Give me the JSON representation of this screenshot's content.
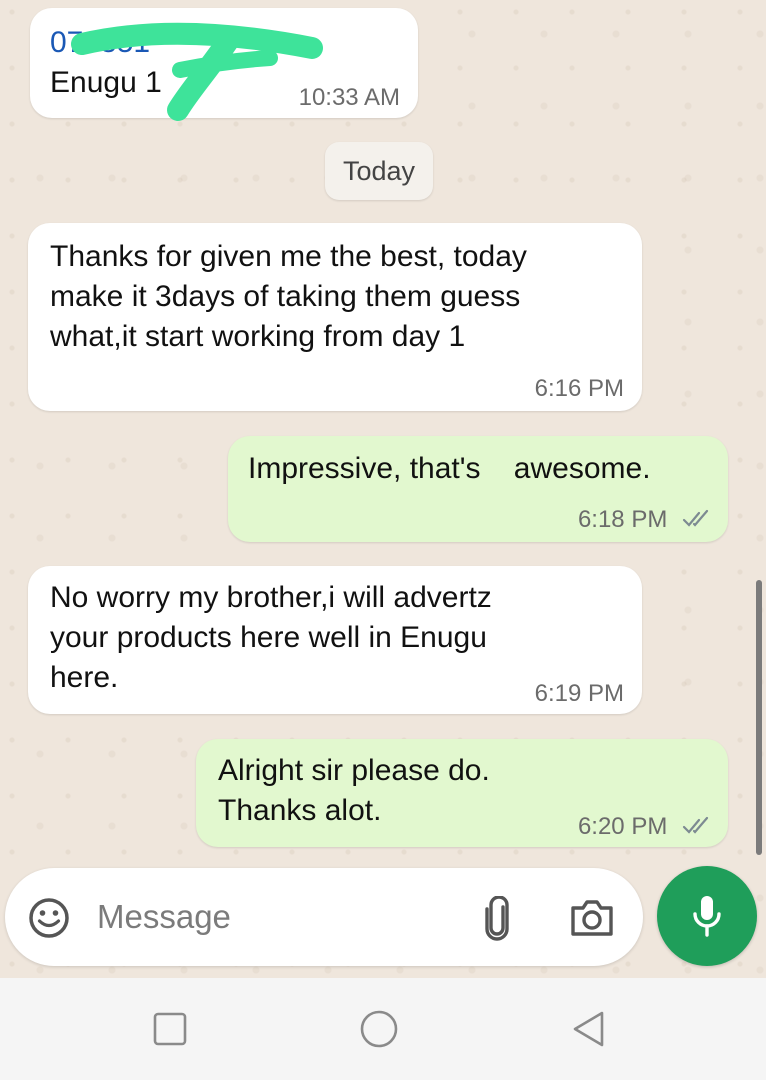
{
  "contact_card": {
    "phone": "070851",
    "location": "Enugu 1",
    "time": "10:33 AM"
  },
  "date_separator": "Today",
  "messages": [
    {
      "direction": "incoming",
      "text": "Thanks  for given  me the best, today\nmake  it 3days of taking  them guess\nwhat,it start  working  from day 1",
      "time": "6:16 PM"
    },
    {
      "direction": "outgoing",
      "text": "Impressive, that's    awesome.",
      "time": "6:18 PM",
      "status": "read-double-check-icon"
    },
    {
      "direction": "incoming",
      "text": "No worry  my brother,i will  advertz\nyour  products here well in Enugu\nhere.",
      "time": "6:19 PM"
    },
    {
      "direction": "outgoing",
      "text": "Alright  sir please  do.\nThanks alot.",
      "time": "6:20 PM",
      "status": "read-double-check-icon"
    }
  ],
  "composer": {
    "placeholder": "Message",
    "icons": [
      "emoji-icon",
      "attach-icon",
      "camera-icon",
      "mic-icon"
    ]
  },
  "colors": {
    "chat_background": "#efe6dc",
    "incoming_bubble": "#ffffff",
    "outgoing_bubble": "#e2f8cf",
    "mic_button": "#1f9e5a",
    "scribble": "#3ee39a",
    "phone_link": "#1a58b5"
  },
  "navigation_bar": [
    "recent-apps-icon",
    "home-icon",
    "back-icon"
  ]
}
